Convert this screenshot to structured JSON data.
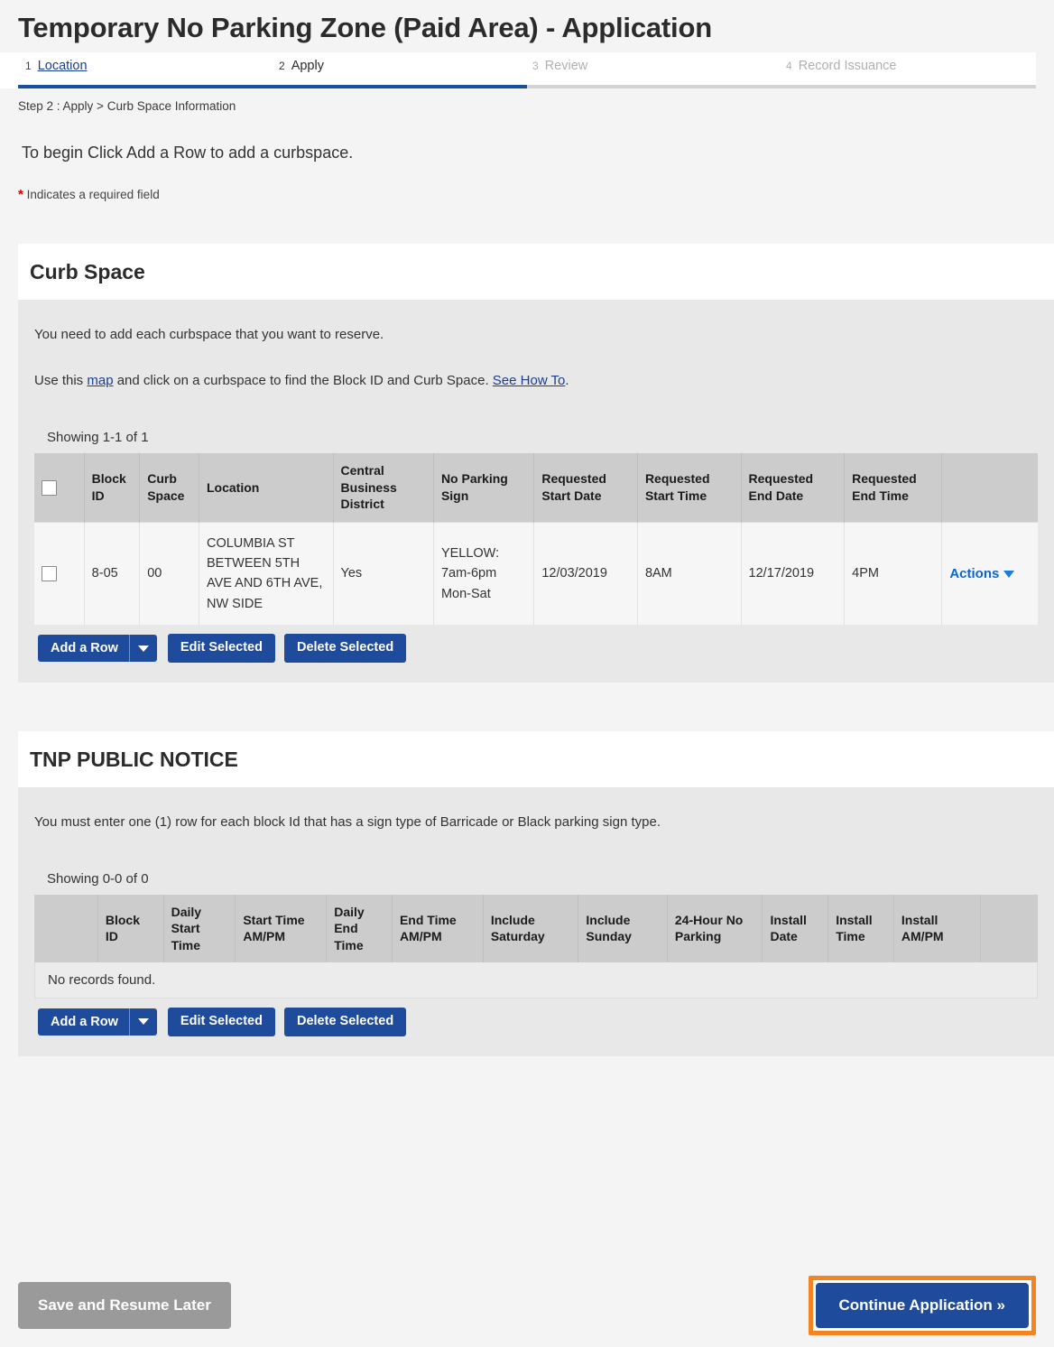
{
  "page": {
    "title": "Temporary No Parking Zone (Paid Area) - Application",
    "breadcrumb": "Step 2 : Apply > Curb Space Information",
    "intro": "To begin Click Add a Row to add a curbspace.",
    "required_star": "*",
    "required_note": "Indicates a required field"
  },
  "wizard": {
    "steps": [
      {
        "num": "1",
        "label": "Location",
        "state": "done"
      },
      {
        "num": "2",
        "label": "Apply",
        "state": "current"
      },
      {
        "num": "3",
        "label": "Review",
        "state": "future"
      },
      {
        "num": "4",
        "label": "Record Issuance",
        "state": "future"
      }
    ],
    "progress_percent": 50
  },
  "curb_space": {
    "heading": "Curb Space",
    "text_1": "You need to add each curbspace that you want to reserve.",
    "text_2_pre": "Use this ",
    "map_link": "map",
    "text_2_mid": " and click on a curbspace to find the Block ID and Curb Space. ",
    "how_to_link": "See How To",
    "text_2_post": ".",
    "showing": "Showing 1-1 of 1",
    "columns": [
      "",
      "Block ID",
      "Curb Space",
      "Location",
      "Central Business District",
      "No Parking Sign",
      "Requested Start Date",
      "Requested Start Time",
      "Requested End Date",
      "Requested End Time",
      ""
    ],
    "row": {
      "block_id": "8-05",
      "curb_space": "00",
      "location": "COLUMBIA ST BETWEEN 5TH AVE AND 6TH AVE, NW SIDE",
      "central_business_district": "Yes",
      "no_parking_sign": "YELLOW: 7am-6pm Mon-Sat",
      "requested_start_date": "12/03/2019",
      "requested_start_time": "8AM",
      "requested_end_date": "12/17/2019",
      "requested_end_time": "4PM",
      "actions_label": "Actions"
    },
    "buttons": {
      "add_row": "Add a Row",
      "edit_selected": "Edit Selected",
      "delete_selected": "Delete Selected"
    }
  },
  "tnp_notice": {
    "heading": "TNP PUBLIC NOTICE",
    "text_1": "You must enter one (1) row for each block Id that has a sign type of Barricade or Black parking sign type.",
    "showing": "Showing 0-0 of 0",
    "columns": [
      "",
      "Block ID",
      "Daily Start Time",
      "Start Time AM/PM",
      "Daily End Time",
      "End Time AM/PM",
      "Include Saturday",
      "Include Sunday",
      "24-Hour No Parking",
      "Install Date",
      "Install Time",
      "Install AM/PM",
      ""
    ],
    "empty_message": "No records found.",
    "buttons": {
      "add_row": "Add a Row",
      "edit_selected": "Edit Selected",
      "delete_selected": "Delete Selected"
    }
  },
  "footer": {
    "save_label": "Save and Resume Later",
    "continue_label": "Continue Application »"
  },
  "colors": {
    "primary_blue": "#1e4b9c",
    "progress_blue": "#16519e",
    "link_blue": "#1a3f8f",
    "actions_blue": "#0b66d0",
    "focus_orange": "#f28421",
    "required_red": "#d40000",
    "panel_gray": "#e8e8e8",
    "header_gray": "#cccccc",
    "save_gray": "#9a9a9a"
  }
}
